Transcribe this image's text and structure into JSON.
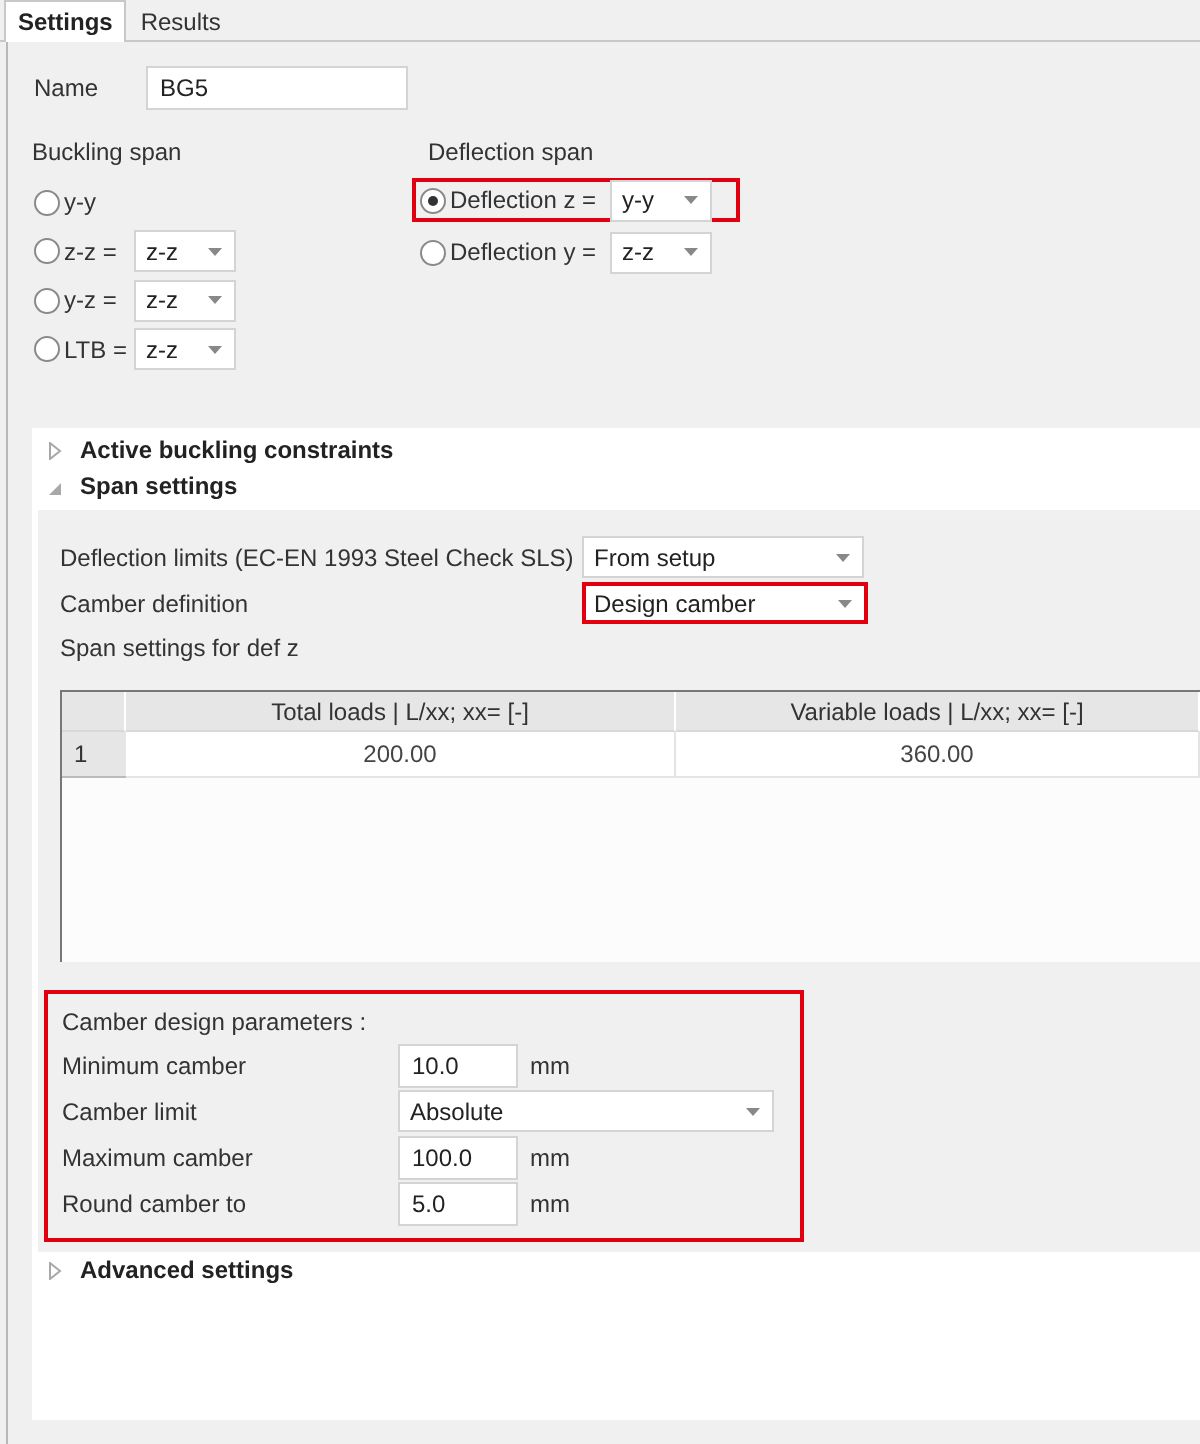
{
  "tabs": [
    {
      "label": "Settings",
      "selected": true
    },
    {
      "label": "Results",
      "selected": false
    }
  ],
  "name": {
    "label": "Name",
    "value": "BG5"
  },
  "buckling_span": {
    "title": "Buckling span",
    "options": [
      {
        "label": "y-y",
        "selected": false
      },
      {
        "label": "z-z =",
        "selected": false,
        "value": "z-z"
      },
      {
        "label": "y-z =",
        "selected": false,
        "value": "z-z"
      },
      {
        "label": "LTB =",
        "selected": false,
        "value": "z-z"
      }
    ]
  },
  "deflection_span": {
    "title": "Deflection span",
    "options": [
      {
        "label": "Deflection z =",
        "selected": true,
        "value": "y-y",
        "highlighted": true
      },
      {
        "label": "Deflection y =",
        "selected": false,
        "value": "z-z",
        "highlighted": false
      }
    ]
  },
  "sections": [
    {
      "title": "Active buckling constraints",
      "expanded": false
    },
    {
      "title": "Span settings",
      "expanded": true,
      "body": {
        "fields": [
          {
            "label": "Deflection limits (EC-EN 1993 Steel Check SLS)",
            "value": "From setup",
            "highlighted": false
          },
          {
            "label": "Camber definition",
            "value": "Design camber",
            "highlighted": true
          }
        ],
        "table_caption": "Span settings for def z",
        "table": {
          "columns": [
            "Total loads | L/xx; xx= [-]",
            "Variable loads | L/xx; xx= [-]"
          ],
          "rows": [
            {
              "header": "1",
              "cells": [
                "200.00",
                "360.00"
              ]
            }
          ]
        },
        "camber": {
          "title": "Camber design parameters :",
          "highlighted": true,
          "fields": [
            {
              "kind": "number",
              "label": "Minimum camber",
              "value": "10.0",
              "unit": "mm"
            },
            {
              "kind": "dropdown",
              "label": "Camber limit",
              "value": "Absolute"
            },
            {
              "kind": "number",
              "label": "Maximum camber",
              "value": "100.0",
              "unit": "mm"
            },
            {
              "kind": "number",
              "label": "Round camber to",
              "value": "5.0",
              "unit": "mm"
            }
          ]
        }
      }
    },
    {
      "title": "Advanced settings",
      "expanded": false
    }
  ]
}
